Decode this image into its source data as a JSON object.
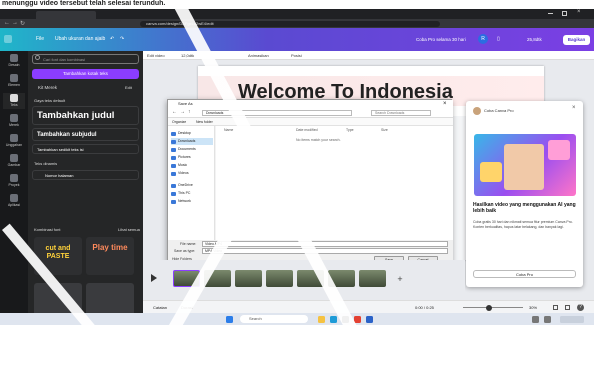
{
  "caption": "menunggu video tersebut telah selesai terunduh.",
  "browser": {
    "url": "canva.com/design/DAFgxLo2wE4/edit"
  },
  "canva_header": {
    "menu_items": [
      "File",
      "Ubah ukuran dan ajaib"
    ],
    "try_pro": "Coba Pro selama 30 hari",
    "avatar_initial": "R",
    "duration": "25,8dtk",
    "share_label": "Bagikan"
  },
  "rail": {
    "items": [
      "Desain",
      "Elemen",
      "Teks",
      "Merek",
      "Unggahan",
      "Gambar",
      "Proyek",
      "Aplikasi"
    ]
  },
  "panel": {
    "search_placeholder": "Cari font dan kombinasi",
    "add_text_button": "Tambahkan kotak teks",
    "brand_kit": "Kit Merek",
    "edit": "Edit",
    "default_styles_label": "Gaya teks default",
    "heading": "Tambahkan judul",
    "subheading": "Tambahkan subjudul",
    "body": "Tambahkan sedikit teks isi",
    "dynamic_text": "Teks dinamis",
    "page_numbers": "Nomor halaman",
    "font_combinations": "Kombinasi font",
    "see_all": "Lihat semua",
    "combo_1": "cut and PASTE",
    "combo_2": "Play time"
  },
  "toolbar": {
    "items": [
      "Edit video",
      "12,0dtk",
      "Animasikan",
      "Posisi"
    ]
  },
  "page": {
    "title": "Welcome To Indonesia"
  },
  "dialog": {
    "title": "Save As",
    "path": "Downloads",
    "search_placeholder": "Search Downloads",
    "organize": "Organize",
    "new_folder": "New folder",
    "tree": [
      "Desktop",
      "Downloads",
      "Documents",
      "Pictures",
      "Music",
      "Videos",
      "OneDrive",
      "This PC",
      "Network"
    ],
    "columns": [
      "Name",
      "Date modified",
      "Type",
      "Size"
    ],
    "empty_message": "No items match your search.",
    "file_name_label": "File name:",
    "file_name_value": "Video.MP4",
    "save_type_label": "Save as type:",
    "save_type_value": "MP4 Video",
    "hide_folders": "Hide Folders",
    "save_button": "Save",
    "cancel_button": "Cancel"
  },
  "promo": {
    "header": "Coba Canva Pro",
    "title": "Hasilkan video yang menggunakan AI yang lebih baik",
    "body": "Coba gratis 30 hari dan nikmati semua fitur premium Canva Pro. Konten berkualitas, hapus latar belakang, dan banyak lagi.",
    "cta": "Coba Pro"
  },
  "timeline": {
    "add_label": "+"
  },
  "statusbar": {
    "notes": "Catatan",
    "duration": "Durasi",
    "time": "0:00 / 0:25",
    "zoom": "30%"
  },
  "taskbar": {
    "search": "Search"
  }
}
